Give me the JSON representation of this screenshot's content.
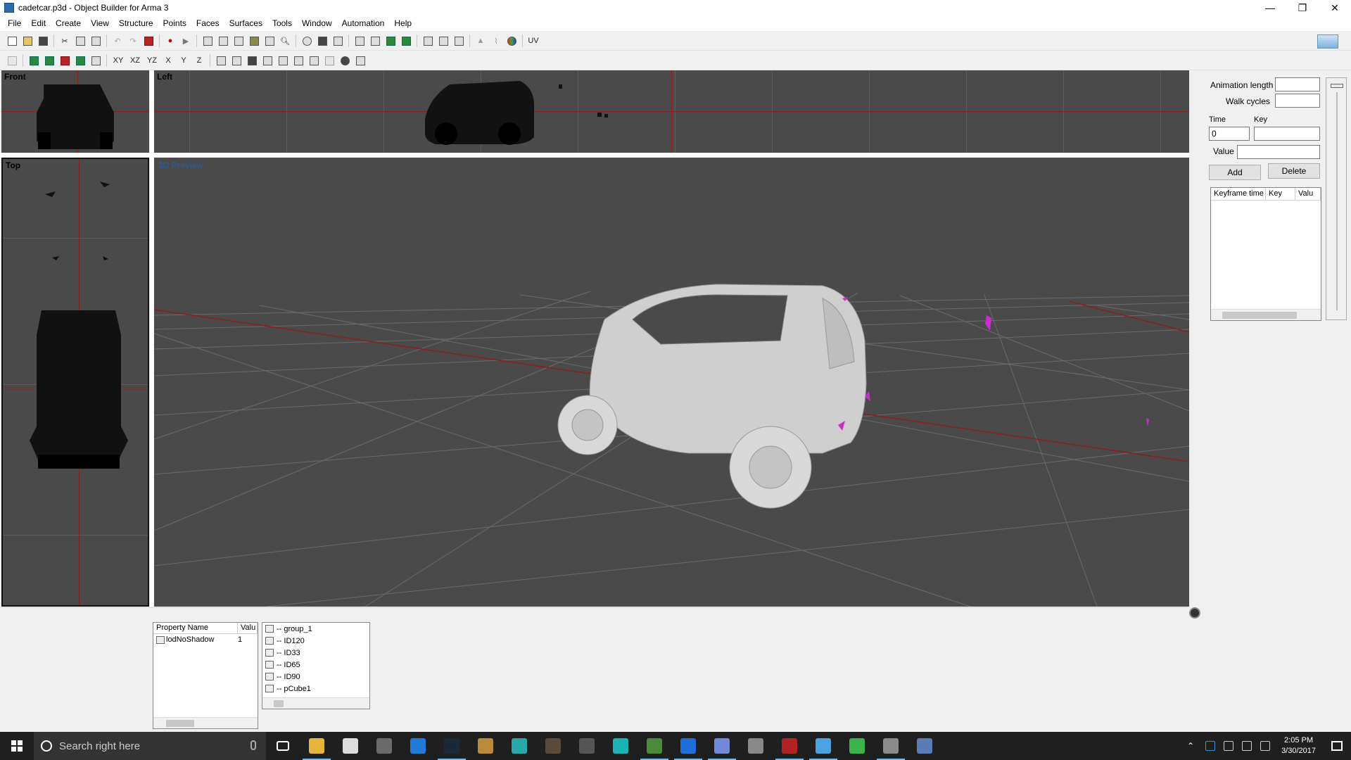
{
  "window": {
    "title": "cadetcar.p3d - Object Builder for Arma 3",
    "minimize_glyph": "—",
    "maximize_glyph": "❐",
    "close_glyph": "✕"
  },
  "menu": [
    "File",
    "Edit",
    "Create",
    "View",
    "Structure",
    "Points",
    "Faces",
    "Surfaces",
    "Tools",
    "Window",
    "Automation",
    "Help"
  ],
  "toolbar1": {
    "icons": [
      "new-file-icon",
      "open-file-icon",
      "save-icon",
      "cut-icon",
      "copy-icon",
      "paste-icon",
      "undo-icon",
      "redo-icon",
      "red-tool-icon",
      "record-icon",
      "play-icon",
      "zoom-rect-icon",
      "select-icon",
      "lasso-icon",
      "paint-icon",
      "transform-icon",
      "zoom-icon",
      "ellipse-select-icon",
      "vertex-select-icon",
      "edge-select-icon",
      "move-icon",
      "scale-icon",
      "rotate-icon",
      "mirror-icon",
      "group-icon",
      "ungroup-icon",
      "lock-icon",
      "normals-icon",
      "smooth-icon",
      "color-icon"
    ],
    "uv_label": "UV"
  },
  "toolbar2": {
    "axis_labels": [
      "XY",
      "XZ",
      "YZ",
      "X",
      "Y",
      "Z"
    ]
  },
  "viewports": {
    "front_label": "Front",
    "left_label": "Left",
    "top_label": "Top",
    "preview_label": "3D Preview"
  },
  "anim_panel": {
    "animation_length_label": "Animation length",
    "animation_length_value": "",
    "walk_cycles_label": "Walk cycles",
    "walk_cycles_value": "",
    "time_label": "Time",
    "time_value": "0",
    "key_label": "Key",
    "key_value": "",
    "value_label": "Value",
    "value_value": "",
    "add_label": "Add",
    "delete_label": "Delete",
    "table_headers": [
      "Keyframe time",
      "Key",
      "Valu"
    ]
  },
  "properties": {
    "headers": [
      "Property Name",
      "Valu"
    ],
    "rows": [
      {
        "name": "lodNoShadow",
        "value": "1"
      }
    ]
  },
  "selections": [
    "-- group_1",
    "-- ID120",
    "-- ID33",
    "-- ID65",
    "-- ID90",
    "-- pCube1"
  ],
  "taskbar": {
    "search_placeholder": "Search right here",
    "apps": [
      {
        "name": "task-view-icon",
        "color": "#1f1f1f"
      },
      {
        "name": "file-explorer-icon",
        "color": "#e8b53a"
      },
      {
        "name": "settings-icon",
        "color": "#dddddd"
      },
      {
        "name": "app-icon-1",
        "color": "#6a6a6a"
      },
      {
        "name": "edge-icon",
        "color": "#1f7ad8"
      },
      {
        "name": "steam-icon",
        "color": "#1b2838"
      },
      {
        "name": "app-icon-2",
        "color": "#b88a3a"
      },
      {
        "name": "app-icon-3",
        "color": "#2aa7a7"
      },
      {
        "name": "app-icon-4",
        "color": "#5a4a3a"
      },
      {
        "name": "calculator-icon",
        "color": "#555555"
      },
      {
        "name": "app-icon-5",
        "color": "#1bb3b3"
      },
      {
        "name": "app-icon-6",
        "color": "#4a8a3a"
      },
      {
        "name": "teamviewer-icon",
        "color": "#1e6fd9"
      },
      {
        "name": "discord-icon",
        "color": "#7289da"
      },
      {
        "name": "app-icon-7",
        "color": "#888888"
      },
      {
        "name": "app-icon-8",
        "color": "#b22222"
      },
      {
        "name": "object-builder-icon",
        "color": "#4aa3df"
      },
      {
        "name": "app-icon-9",
        "color": "#3ab34a"
      },
      {
        "name": "app-icon-10",
        "color": "#8a8a8a"
      },
      {
        "name": "app-icon-11",
        "color": "#5a7ab8"
      }
    ],
    "time": "2:05 PM",
    "date": "3/30/2017"
  },
  "colors": {
    "viewport_bg": "#4a4a4a",
    "axis_red": "#8a1f1f",
    "highlight_magenta": "#d02bd0",
    "model_gray": "#cfcfcf"
  }
}
